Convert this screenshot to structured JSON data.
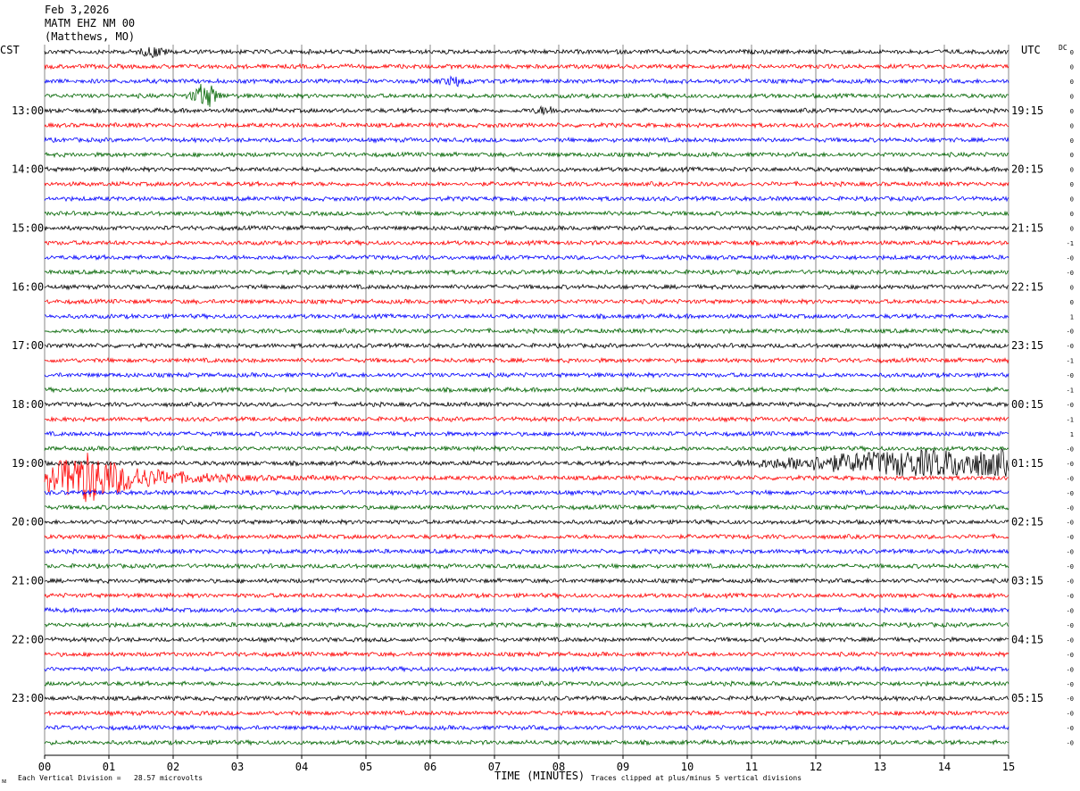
{
  "header": {
    "date": "Feb 3,2026",
    "station": "MATM EHZ NM 00",
    "location": "(Matthews, MO)"
  },
  "left_tz": "CST",
  "right_tz": "UTC",
  "dc_label": "DC",
  "footer": {
    "scale": "Each Vertical Division =   28.57 microvolts",
    "xlabel": "TIME (MINUTES)",
    "clip": "Traces clipped at plus/minus 5 vertical divisions",
    "corner": "ᴍ"
  },
  "colors": {
    "black": "#000000",
    "red": "#ff0000",
    "blue": "#0000ff",
    "green": "#006400",
    "grid": "#555555"
  },
  "chart_data": {
    "type": "line",
    "title": "",
    "xlabel": "TIME (MINUTES)",
    "xlim": [
      0,
      15
    ],
    "x_ticks": [
      "00",
      "01",
      "02",
      "03",
      "04",
      "05",
      "06",
      "07",
      "08",
      "09",
      "10",
      "11",
      "12",
      "13",
      "14",
      "15"
    ],
    "trace_count": 48,
    "trace_colors": [
      "black",
      "red",
      "blue",
      "green"
    ],
    "left_hour_labels": [
      {
        "trace": 4,
        "label": "13:00"
      },
      {
        "trace": 8,
        "label": "14:00"
      },
      {
        "trace": 12,
        "label": "15:00"
      },
      {
        "trace": 16,
        "label": "16:00"
      },
      {
        "trace": 20,
        "label": "17:00"
      },
      {
        "trace": 24,
        "label": "18:00"
      },
      {
        "trace": 28,
        "label": "19:00"
      },
      {
        "trace": 32,
        "label": "20:00"
      },
      {
        "trace": 36,
        "label": "21:00"
      },
      {
        "trace": 40,
        "label": "22:00"
      },
      {
        "trace": 44,
        "label": "23:00"
      }
    ],
    "right_hour_labels": [
      {
        "trace": 4,
        "label": "19:15"
      },
      {
        "trace": 8,
        "label": "20:15"
      },
      {
        "trace": 12,
        "label": "21:15"
      },
      {
        "trace": 16,
        "label": "22:15"
      },
      {
        "trace": 20,
        "label": "23:15"
      },
      {
        "trace": 24,
        "label": "00:15"
      },
      {
        "trace": 28,
        "label": "01:15"
      },
      {
        "trace": 32,
        "label": "02:15"
      },
      {
        "trace": 36,
        "label": "03:15"
      },
      {
        "trace": 40,
        "label": "04:15"
      },
      {
        "trace": 44,
        "label": "05:15"
      }
    ],
    "dc_offsets": [
      "0",
      "0",
      "0",
      "0",
      "0",
      "0",
      "0",
      "0",
      "0",
      "0",
      "0",
      "0",
      "0",
      "-1",
      "-0",
      "-0",
      "0",
      "0",
      "1",
      "-0",
      "-0",
      "-1",
      "-0",
      "-1",
      "-0",
      "-1",
      "1",
      "-0",
      "-0",
      "-0",
      "-0",
      "-0",
      "-0",
      "-0",
      "-0",
      "-0",
      "-0",
      "-0",
      "-0",
      "-0",
      "-0",
      "-0",
      "-0",
      "-0",
      "-0",
      "-0",
      "-0",
      "-0"
    ],
    "events": [
      {
        "trace": 0,
        "minute": 1.7,
        "amplitude": 0.6
      },
      {
        "trace": 2,
        "minute": 6.4,
        "amplitude": 0.5
      },
      {
        "trace": 3,
        "minute": 2.5,
        "amplitude": 1.6
      },
      {
        "trace": 4,
        "minute": 7.8,
        "amplitude": 0.4
      },
      {
        "trace": 28,
        "minute": 13.8,
        "amplitude": 2.2
      },
      {
        "trace": 29,
        "minute": 0.65,
        "amplitude": 3.5
      }
    ]
  }
}
